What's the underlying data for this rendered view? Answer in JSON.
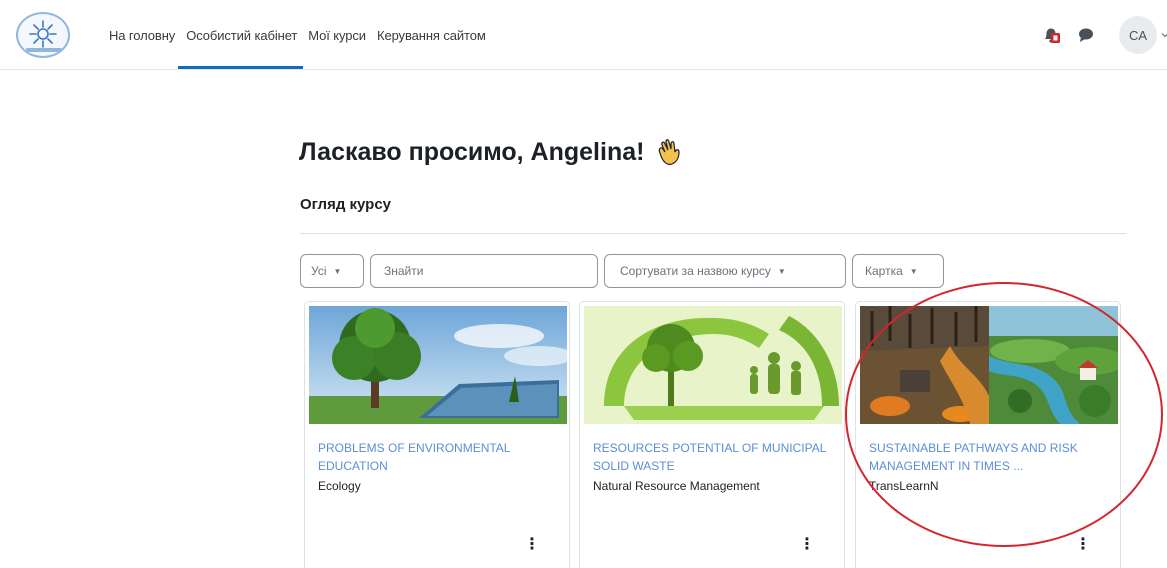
{
  "navbar": {
    "links": [
      {
        "label": "На головну",
        "active": false
      },
      {
        "label": "Особистий кабінет",
        "active": true
      },
      {
        "label": "Мої курси",
        "active": false
      },
      {
        "label": "Керування сайтом",
        "active": false
      }
    ],
    "user_initials": "CA",
    "icons": {
      "logo": "site-logo",
      "notifications": "bell-icon",
      "messages": "chat-bubble-icon",
      "user_menu": "chevron-down-icon"
    }
  },
  "main": {
    "welcome": "Ласкаво просимо, Angelina!",
    "wave_icon": "waving-hand-icon",
    "section_title": "Огляд курсу"
  },
  "filters": {
    "grouping": "Усі",
    "search_placeholder": "Знайти",
    "sort": "Сортувати за назвою курсу",
    "view": "Картка"
  },
  "courses": [
    {
      "name": "PROBLEMS OF ENVIRONMENTAL EDUCATION",
      "category": "Ecology",
      "image": "tree-and-book-landscape"
    },
    {
      "name": "RESOURCES POTENTIAL OF MUNICIPAL SOLID WASTE",
      "category": "Natural Resource Management",
      "image": "green-recycling-family"
    },
    {
      "name": "SUSTAINABLE PATHWAYS AND RISK MANAGEMENT IN TIMES ...",
      "category": "TransLearnN",
      "image": "war-and-green-landscape"
    }
  ],
  "colors": {
    "accent": "#0f6cbf",
    "link": "#5b8ed6",
    "annotation": "#d3262f"
  }
}
